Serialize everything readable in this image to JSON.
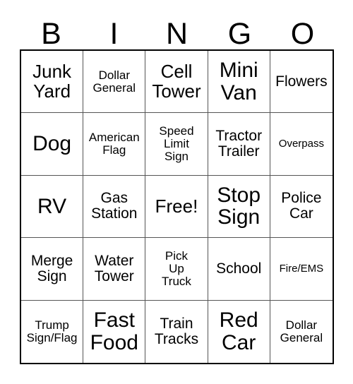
{
  "card": {
    "header_letters": [
      "B",
      "I",
      "N",
      "G",
      "O"
    ],
    "columns": 5,
    "rows": 5,
    "free_space_label": "Free!",
    "colors": {
      "background": "#ffffff",
      "text": "#000000",
      "outer_border": "#000000",
      "inner_border": "#555555"
    },
    "cells": [
      {
        "text": "Junk\nYard",
        "size": "lg"
      },
      {
        "text": "Dollar\nGeneral",
        "size": "sm"
      },
      {
        "text": "Cell\nTower",
        "size": "lg"
      },
      {
        "text": "Mini\nVan",
        "size": "xl"
      },
      {
        "text": "Flowers",
        "size": "md"
      },
      {
        "text": "Dog",
        "size": "xl"
      },
      {
        "text": "American\nFlag",
        "size": "sm"
      },
      {
        "text": "Speed\nLimit\nSign",
        "size": "sm"
      },
      {
        "text": "Tractor\nTrailer",
        "size": "md"
      },
      {
        "text": "Overpass",
        "size": "xs"
      },
      {
        "text": "RV",
        "size": "xl"
      },
      {
        "text": "Gas\nStation",
        "size": "md"
      },
      {
        "text": "Free!",
        "size": "lg"
      },
      {
        "text": "Stop\nSign",
        "size": "xl"
      },
      {
        "text": "Police\nCar",
        "size": "md"
      },
      {
        "text": "Merge\nSign",
        "size": "md"
      },
      {
        "text": "Water\nTower",
        "size": "md"
      },
      {
        "text": "Pick\nUp\nTruck",
        "size": "sm"
      },
      {
        "text": "School",
        "size": "md"
      },
      {
        "text": "Fire/EMS",
        "size": "xs"
      },
      {
        "text": "Trump\nSign/Flag",
        "size": "sm"
      },
      {
        "text": "Fast\nFood",
        "size": "xl"
      },
      {
        "text": "Train\nTracks",
        "size": "md"
      },
      {
        "text": "Red\nCar",
        "size": "xl"
      },
      {
        "text": "Dollar\nGeneral",
        "size": "sm"
      }
    ]
  }
}
